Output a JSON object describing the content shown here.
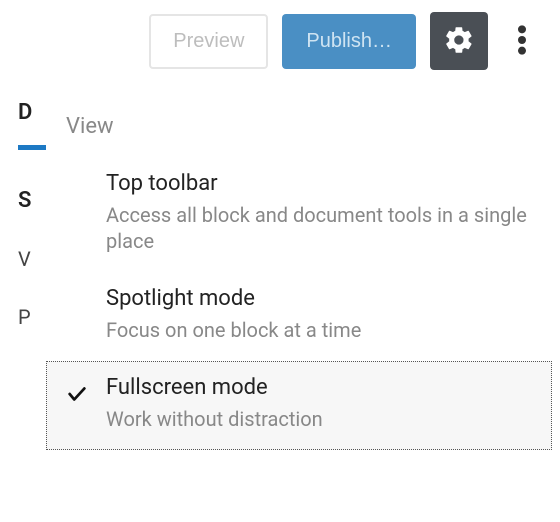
{
  "toolbar": {
    "preview_label": "Preview",
    "publish_label": "Publish…"
  },
  "sidebar": {
    "tab_letter": "D",
    "section_letter": "S",
    "row1": "V",
    "row2": "P"
  },
  "dropdown": {
    "header": "View",
    "items": [
      {
        "title": "Top toolbar",
        "desc": "Access all block and document tools in a single place",
        "checked": false
      },
      {
        "title": "Spotlight mode",
        "desc": "Focus on one block at a time",
        "checked": false
      },
      {
        "title": "Fullscreen mode",
        "desc": "Work without distraction",
        "checked": true
      }
    ]
  }
}
